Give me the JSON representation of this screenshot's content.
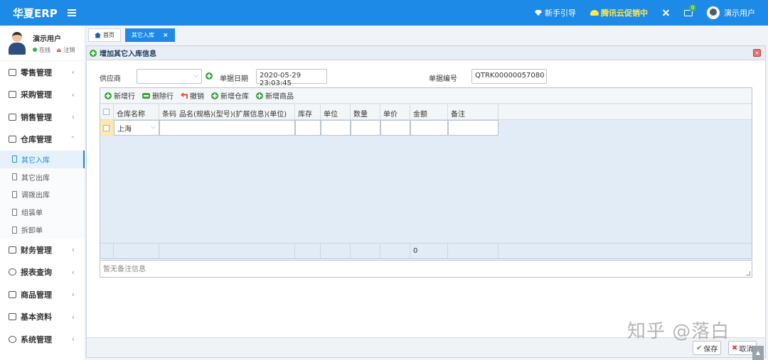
{
  "app": {
    "brand": "华夏ERP"
  },
  "header": {
    "guide": "新手引导",
    "promo": "腾讯云促销中",
    "mail_badge": "0",
    "user": "演示用户"
  },
  "sidebar": {
    "user_name": "演示用户",
    "status_online": "在线",
    "status_logout": "注销",
    "groups": [
      {
        "label": "零售管理"
      },
      {
        "label": "采购管理"
      },
      {
        "label": "销售管理"
      },
      {
        "label": "仓库管理"
      },
      {
        "label": "财务管理"
      },
      {
        "label": "报表查询"
      },
      {
        "label": "商品管理"
      },
      {
        "label": "基本资料"
      },
      {
        "label": "系统管理"
      }
    ],
    "warehouse_items": [
      {
        "label": "其它入库"
      },
      {
        "label": "其它出库"
      },
      {
        "label": "调拨出库"
      },
      {
        "label": "组装单"
      },
      {
        "label": "拆卸单"
      }
    ]
  },
  "tabs": [
    {
      "label": "首页"
    },
    {
      "label": "其它入库"
    }
  ],
  "panel": {
    "title": "增加其它入库信息",
    "supplier_label": "供应商",
    "supplier_value": "",
    "date_label": "单据日期",
    "date_value": "2020-05-29 23:03:45",
    "number_label": "单据编号",
    "number_value": "QTRK00000057080"
  },
  "toolbar": {
    "add_row": "新增行",
    "delete_row": "删除行",
    "undo": "撤销",
    "add_warehouse": "新增仓库",
    "add_product": "新增商品"
  },
  "grid": {
    "columns": [
      "仓库名称",
      "条码",
      "品名(规格)(型号)(扩展信息)(单位)",
      "库存",
      "单位",
      "数量",
      "单价",
      "金额",
      "备注"
    ],
    "rows": [
      {
        "warehouse": "上海"
      }
    ],
    "footer_amount": "0"
  },
  "remark": {
    "placeholder": "暂无备注信息"
  },
  "actions": {
    "save": "保存",
    "cancel": "取消"
  },
  "watermark": "知乎 @落白"
}
